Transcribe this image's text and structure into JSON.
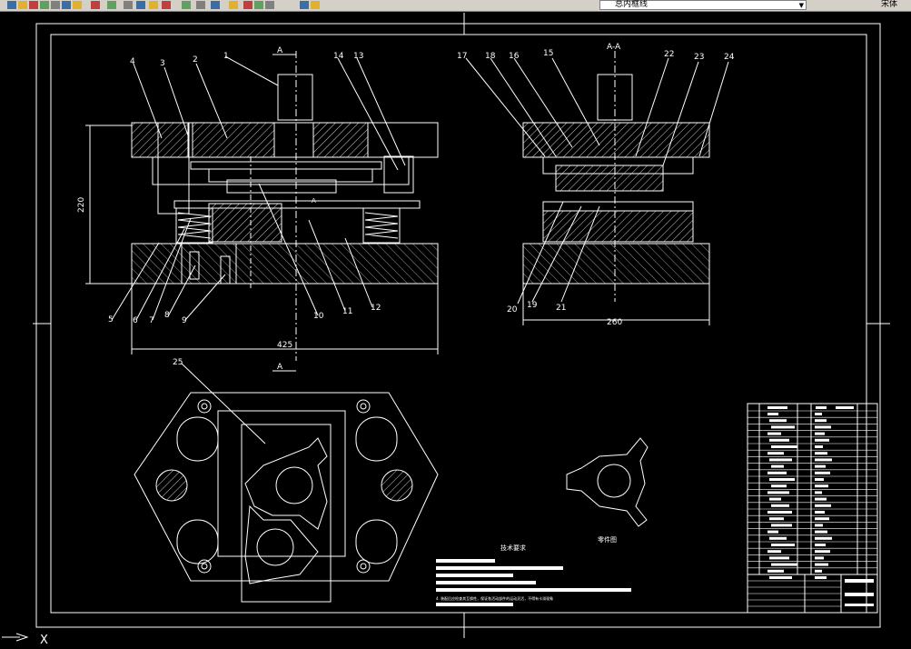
{
  "toolbar": {
    "layer_name": "总内框线",
    "right_label": "宋体",
    "icons": [
      "open-icon",
      "save-icon",
      "print-icon",
      "cut-icon",
      "copy-icon",
      "paste-icon",
      "undo-icon",
      "redo-icon",
      "pan-icon",
      "zoom-realtime-icon",
      "zoom-window-icon",
      "zoom-previous-icon",
      "properties-icon",
      "design-center-icon",
      "tool-palette-icon",
      "help-icon",
      "layer-manager-icon",
      "layer-bulb-icon",
      "layer-sun-icon",
      "layer-lock-icon",
      "layer-color-icon",
      "text-style-icon"
    ]
  },
  "drawing": {
    "part_numbers_front": [
      "1",
      "2",
      "3",
      "4",
      "5",
      "6",
      "7",
      "8",
      "9",
      "10",
      "11",
      "12",
      "13",
      "14"
    ],
    "part_numbers_side": [
      "15",
      "16",
      "17",
      "18",
      "19",
      "20",
      "21",
      "22",
      "23",
      "24"
    ],
    "part_number_plan": "25",
    "section_label_top": "A",
    "section_label_bottom": "A",
    "section_label_mid": "A",
    "section_view_title": "A-A",
    "dim_width_front": "425",
    "dim_height_front": "220",
    "dim_width_side": "260",
    "tech_requirements_title": "技术要求",
    "part_drawing_label": "零件图",
    "tech_note_line": "4. 装配后应检查其互换性，保证各活动部件的运动灵活，不得有卡滞现象"
  },
  "command_line": {
    "prompt": "X"
  },
  "colors": {
    "background": "#000000",
    "lines": "#ffffff",
    "toolbar": "#d4d0c8"
  }
}
